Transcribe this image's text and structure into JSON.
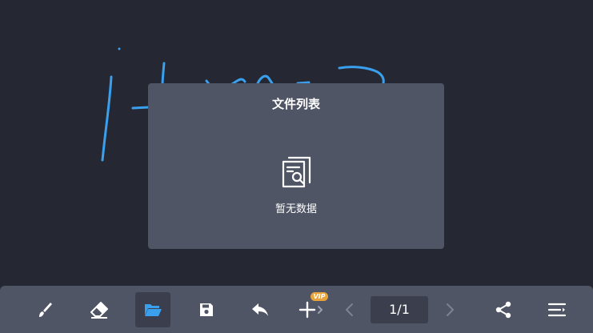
{
  "modal": {
    "title": "文件列表",
    "empty_text": "暂无数据",
    "empty_icon": "file-search-icon"
  },
  "toolbar": {
    "tools": [
      {
        "name": "brush-icon",
        "label": "brush"
      },
      {
        "name": "eraser-icon",
        "label": "eraser"
      },
      {
        "name": "folder-icon",
        "label": "open folder",
        "active": true
      },
      {
        "name": "save-icon",
        "label": "save"
      },
      {
        "name": "undo-icon",
        "label": "undo"
      },
      {
        "name": "add-page-icon",
        "label": "add page"
      },
      {
        "name": "prev-page-icon",
        "label": "previous page"
      },
      {
        "name": "next-page-icon",
        "label": "next page"
      },
      {
        "name": "share-icon",
        "label": "share"
      },
      {
        "name": "menu-icon",
        "label": "menu"
      }
    ],
    "vip_badge": "VIP",
    "page_indicator": "1/1"
  },
  "colors": {
    "background": "#252833",
    "panel": "#4f5565",
    "active_tool": "#3b3f4d",
    "stroke": "#3aa0ee",
    "accent": "#3aa0ee",
    "vip": "#e8a33b"
  }
}
